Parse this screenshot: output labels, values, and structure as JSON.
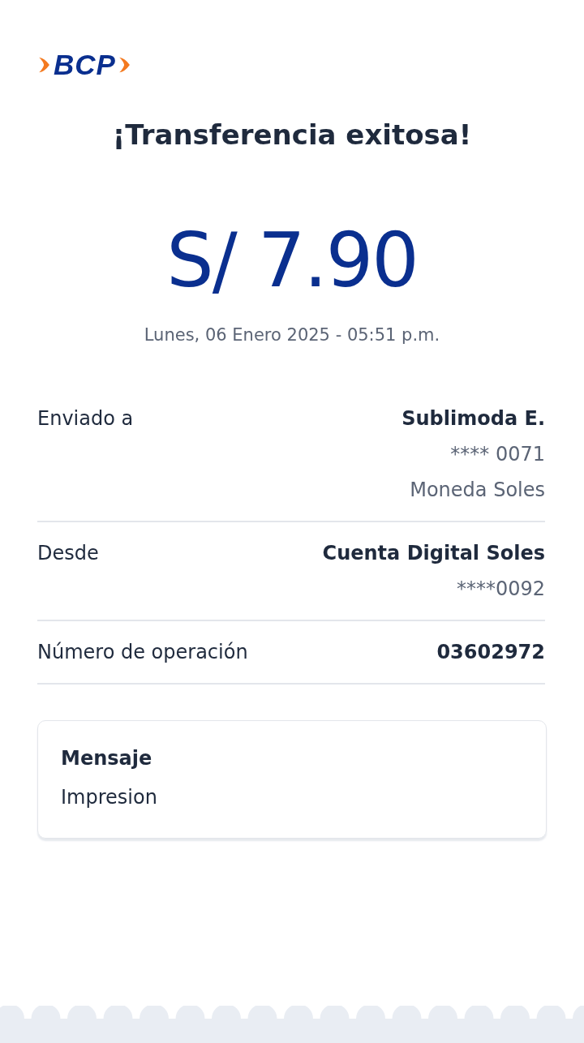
{
  "logo": {
    "text": "BCP"
  },
  "title": "¡Transferencia exitosa!",
  "amount": "S/ 7.90",
  "datetime": "Lunes, 06 Enero 2025 - 05:51 p.m.",
  "details": [
    {
      "label": "Enviado a",
      "lines": [
        {
          "text": "Sublimoda E.",
          "kind": "strong"
        },
        {
          "text": "**** 0071",
          "kind": "muted"
        },
        {
          "text": "Moneda Soles",
          "kind": "muted"
        }
      ]
    },
    {
      "label": "Desde",
      "lines": [
        {
          "text": "Cuenta Digital Soles",
          "kind": "strong"
        },
        {
          "text": "****0092",
          "kind": "muted"
        }
      ]
    },
    {
      "label": "Número de operación",
      "lines": [
        {
          "text": "03602972",
          "kind": "strong"
        }
      ]
    }
  ],
  "message": {
    "title": "Mensaje",
    "text": "Impresion"
  }
}
